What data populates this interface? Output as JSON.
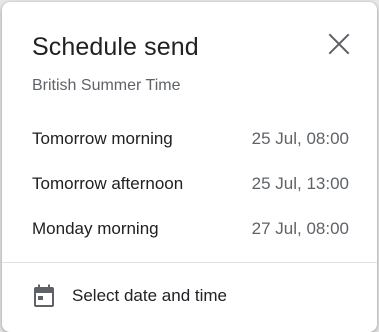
{
  "dialog": {
    "title": "Schedule send",
    "subtitle": "British Summer Time",
    "options": [
      {
        "label": "Tomorrow morning",
        "time": "25 Jul, 08:00"
      },
      {
        "label": "Tomorrow afternoon",
        "time": "25 Jul, 13:00"
      },
      {
        "label": "Monday morning",
        "time": "27 Jul, 08:00"
      }
    ],
    "custom_label": "Select date and time",
    "icons": {
      "close": "close-icon",
      "calendar": "calendar-icon"
    },
    "colors": {
      "text_primary": "#202124",
      "text_secondary": "#5f6368",
      "icon": "#5f6368"
    }
  }
}
